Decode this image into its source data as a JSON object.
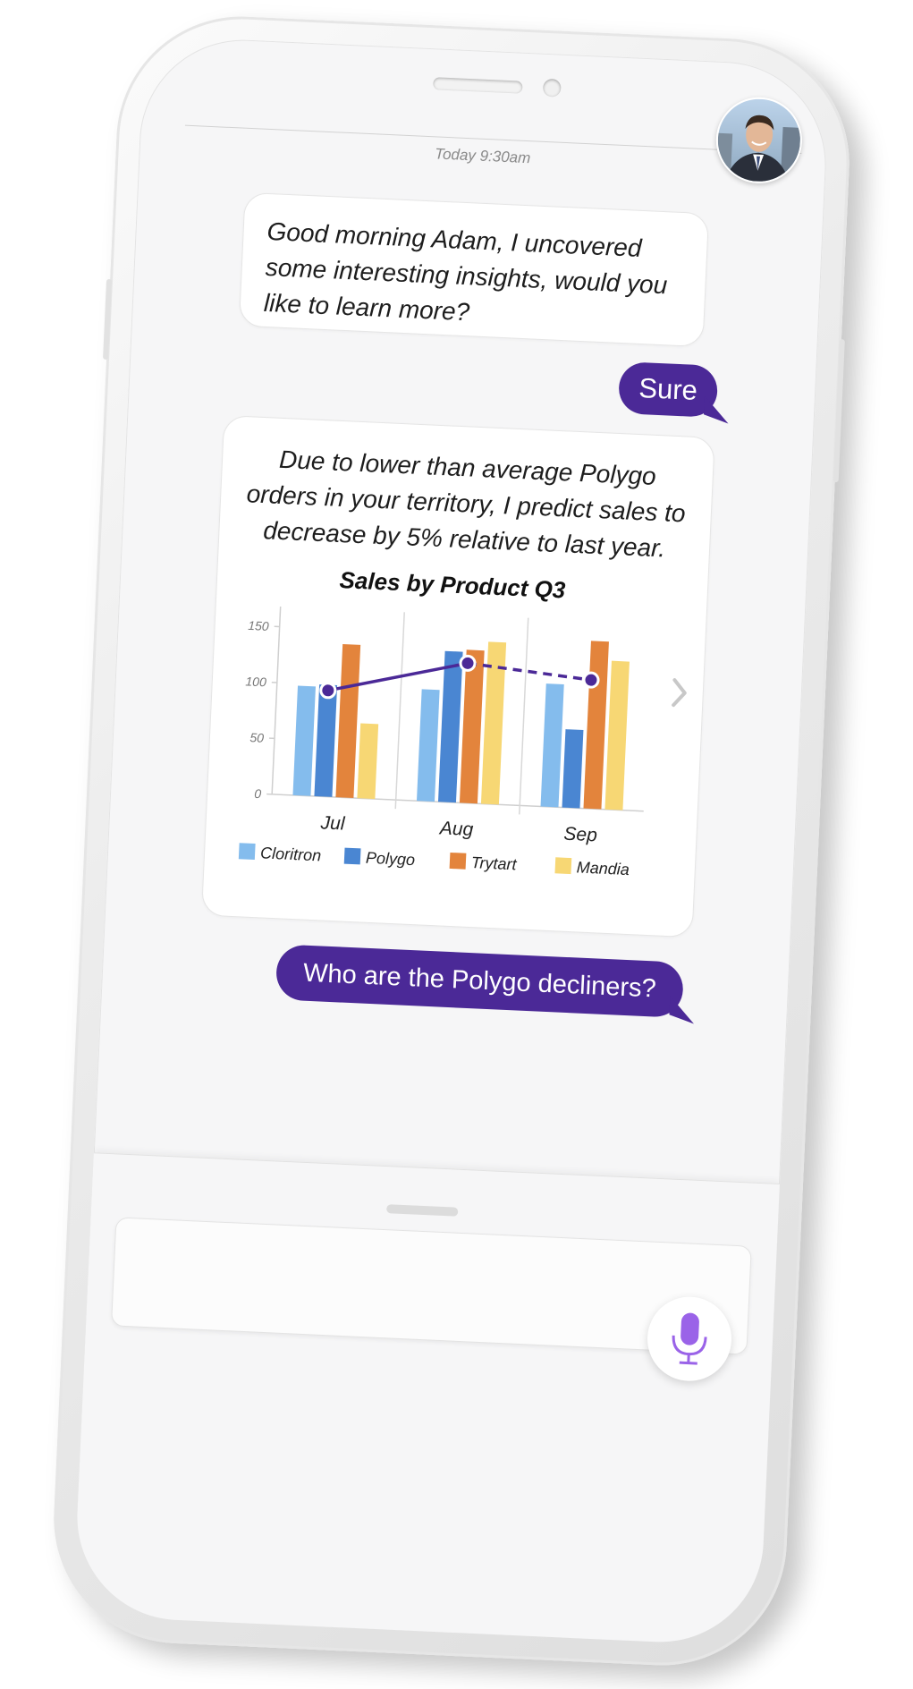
{
  "header": {
    "timestamp": "Today 9:30am"
  },
  "messages": [
    {
      "sender": "bot",
      "text": "Good morning Adam, I uncovered some interesting insights, would you like to learn more?"
    },
    {
      "sender": "user",
      "text": "Sure"
    },
    {
      "sender": "bot",
      "text": "Due to lower than average Polygo orders in your territory, I predict sales to decrease by 5% relative to last year."
    },
    {
      "sender": "user",
      "text": "Who are the Polygo decliners?"
    }
  ],
  "chart_data": {
    "type": "bar",
    "title": "Sales by Product Q3",
    "categories": [
      "Jul",
      "Aug",
      "Sep"
    ],
    "series": [
      {
        "name": "Cloritron",
        "values": [
          98,
          100,
          110
        ],
        "color": "#84bced"
      },
      {
        "name": "Polygo",
        "values": [
          100,
          135,
          70
        ],
        "color": "#4a86d2"
      },
      {
        "name": "Trytart",
        "values": [
          137,
          137,
          150
        ],
        "color": "#e3843c"
      },
      {
        "name": "Mandia",
        "values": [
          67,
          145,
          133
        ],
        "color": "#f7d774"
      }
    ],
    "trend_line": {
      "values": [
        95,
        125,
        115
      ],
      "color": "#4b2997",
      "solid_until_index": 1
    },
    "yticks": [
      0,
      50,
      100,
      150
    ],
    "ylim": [
      0,
      160
    ],
    "grid": true,
    "legend_position": "bottom"
  },
  "input": {
    "mic_icon": "microphone-icon"
  },
  "colors": {
    "accent": "#4b2997",
    "mic": "#9a63e8",
    "screen_bg": "#f6f6f7"
  }
}
